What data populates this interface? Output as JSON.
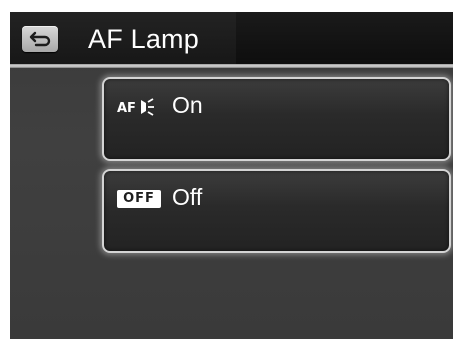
{
  "header": {
    "title": "AF Lamp",
    "back_icon": "return-arrow-icon"
  },
  "options": [
    {
      "icon": "af-lamp-on-icon",
      "icon_text": "AF",
      "label": "On"
    },
    {
      "icon": "off-icon",
      "icon_text": "OFF",
      "label": "Off"
    }
  ],
  "colors": {
    "background": "#3a3a3a",
    "title_bar": "#141414",
    "text": "#ffffff",
    "option_border": "#d4d4d4"
  }
}
